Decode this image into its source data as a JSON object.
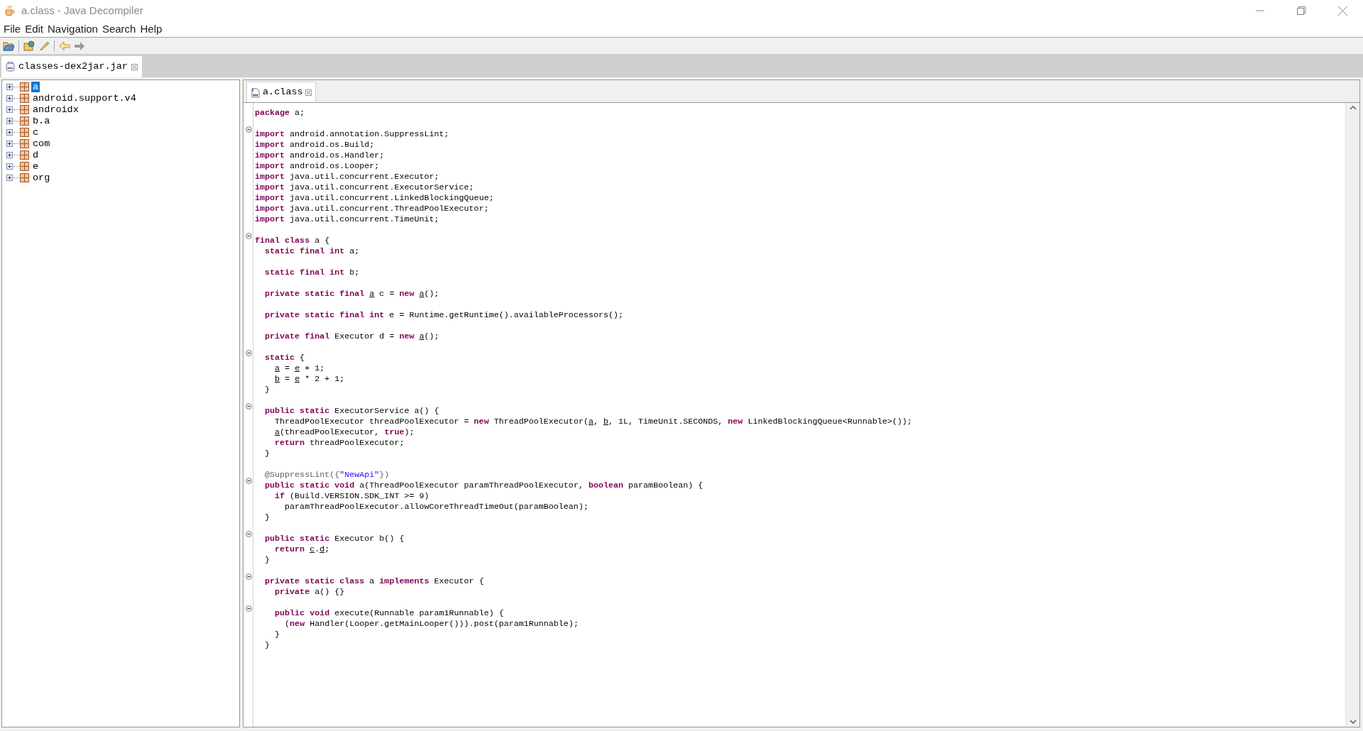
{
  "window": {
    "title": "a.class - Java Decompiler"
  },
  "menu": [
    {
      "label": "File"
    },
    {
      "label": "Edit"
    },
    {
      "label": "Navigation"
    },
    {
      "label": "Search"
    },
    {
      "label": "Help"
    }
  ],
  "left_tabs": [
    {
      "label": "classes-dex2jar.jar",
      "selected": true
    }
  ],
  "tree": {
    "items": [
      {
        "label": "a",
        "selected": true,
        "expanded": false
      },
      {
        "label": "android.support.v4",
        "selected": false,
        "expanded": false
      },
      {
        "label": "androidx",
        "selected": false,
        "expanded": false
      },
      {
        "label": "b.a",
        "selected": false,
        "expanded": false
      },
      {
        "label": "c",
        "selected": false,
        "expanded": false
      },
      {
        "label": "com",
        "selected": false,
        "expanded": false
      },
      {
        "label": "d",
        "selected": false,
        "expanded": false
      },
      {
        "label": "e",
        "selected": false,
        "expanded": false
      },
      {
        "label": "org",
        "selected": false,
        "expanded": false
      }
    ]
  },
  "editor_tabs": [
    {
      "label": "a.class",
      "selected": true
    }
  ],
  "code": {
    "lines": [
      {
        "kind": "code",
        "foldable": false,
        "tokens": [
          {
            "kind": "keyword",
            "text": "package"
          },
          {
            "kind": "plain",
            "text": " a;"
          }
        ]
      },
      {
        "kind": "blank"
      },
      {
        "kind": "code",
        "foldable": true,
        "tokens": [
          {
            "kind": "keyword",
            "text": "import"
          },
          {
            "kind": "plain",
            "text": " android.annotation.SuppressLint;"
          }
        ]
      },
      {
        "kind": "code",
        "foldable": false,
        "tokens": [
          {
            "kind": "keyword",
            "text": "import"
          },
          {
            "kind": "plain",
            "text": " android.os.Build;"
          }
        ]
      },
      {
        "kind": "code",
        "foldable": false,
        "tokens": [
          {
            "kind": "keyword",
            "text": "import"
          },
          {
            "kind": "plain",
            "text": " android.os.Handler;"
          }
        ]
      },
      {
        "kind": "code",
        "foldable": false,
        "tokens": [
          {
            "kind": "keyword",
            "text": "import"
          },
          {
            "kind": "plain",
            "text": " android.os.Looper;"
          }
        ]
      },
      {
        "kind": "code",
        "foldable": false,
        "tokens": [
          {
            "kind": "keyword",
            "text": "import"
          },
          {
            "kind": "plain",
            "text": " java.util.concurrent.Executor;"
          }
        ]
      },
      {
        "kind": "code",
        "foldable": false,
        "tokens": [
          {
            "kind": "keyword",
            "text": "import"
          },
          {
            "kind": "plain",
            "text": " java.util.concurrent.ExecutorService;"
          }
        ]
      },
      {
        "kind": "code",
        "foldable": false,
        "tokens": [
          {
            "kind": "keyword",
            "text": "import"
          },
          {
            "kind": "plain",
            "text": " java.util.concurrent.LinkedBlockingQueue;"
          }
        ]
      },
      {
        "kind": "code",
        "foldable": false,
        "tokens": [
          {
            "kind": "keyword",
            "text": "import"
          },
          {
            "kind": "plain",
            "text": " java.util.concurrent.ThreadPoolExecutor;"
          }
        ]
      },
      {
        "kind": "code",
        "foldable": false,
        "tokens": [
          {
            "kind": "keyword",
            "text": "import"
          },
          {
            "kind": "plain",
            "text": " java.util.concurrent.TimeUnit;"
          }
        ]
      },
      {
        "kind": "blank"
      },
      {
        "kind": "code",
        "foldable": true,
        "tokens": [
          {
            "kind": "keyword",
            "text": "final class"
          },
          {
            "kind": "plain",
            "text": " a {"
          }
        ]
      },
      {
        "kind": "code",
        "foldable": false,
        "tokens": [
          {
            "kind": "keyword",
            "text": "  static final int"
          },
          {
            "kind": "plain",
            "text": " a;"
          }
        ]
      },
      {
        "kind": "blank"
      },
      {
        "kind": "code",
        "foldable": false,
        "tokens": [
          {
            "kind": "keyword",
            "text": "  static final int"
          },
          {
            "kind": "plain",
            "text": " b;"
          }
        ]
      },
      {
        "kind": "blank"
      },
      {
        "kind": "code",
        "foldable": false,
        "tokens": [
          {
            "kind": "keyword",
            "text": "  private static final "
          },
          {
            "kind": "ref",
            "text": "a"
          },
          {
            "kind": "plain",
            "text": " c = "
          },
          {
            "kind": "keyword",
            "text": "new "
          },
          {
            "kind": "ref",
            "text": "a"
          },
          {
            "kind": "plain",
            "text": "();"
          }
        ]
      },
      {
        "kind": "blank"
      },
      {
        "kind": "code",
        "foldable": false,
        "tokens": [
          {
            "kind": "keyword",
            "text": "  private static final int"
          },
          {
            "kind": "plain",
            "text": " e = Runtime.getRuntime().availableProcessors();"
          }
        ]
      },
      {
        "kind": "blank"
      },
      {
        "kind": "code",
        "foldable": false,
        "tokens": [
          {
            "kind": "keyword",
            "text": "  private final"
          },
          {
            "kind": "plain",
            "text": " Executor d = "
          },
          {
            "kind": "keyword",
            "text": "new "
          },
          {
            "kind": "ref",
            "text": "a"
          },
          {
            "kind": "plain",
            "text": "();"
          }
        ]
      },
      {
        "kind": "blank"
      },
      {
        "kind": "code",
        "foldable": true,
        "tokens": [
          {
            "kind": "keyword",
            "text": "  static"
          },
          {
            "kind": "plain",
            "text": " {"
          }
        ]
      },
      {
        "kind": "code",
        "foldable": false,
        "tokens": [
          {
            "kind": "ref",
            "text": "    a"
          },
          {
            "kind": "plain",
            "text": " = "
          },
          {
            "kind": "ref",
            "text": "e"
          },
          {
            "kind": "plain",
            "text": " + 1;"
          }
        ]
      },
      {
        "kind": "code",
        "foldable": false,
        "tokens": [
          {
            "kind": "ref",
            "text": "    b"
          },
          {
            "kind": "plain",
            "text": " = "
          },
          {
            "kind": "ref",
            "text": "e"
          },
          {
            "kind": "plain",
            "text": " * 2 + 1;"
          }
        ]
      },
      {
        "kind": "code",
        "foldable": false,
        "tokens": [
          {
            "kind": "plain",
            "text": "  }"
          }
        ]
      },
      {
        "kind": "blank"
      },
      {
        "kind": "code",
        "foldable": true,
        "tokens": [
          {
            "kind": "keyword",
            "text": "  public static"
          },
          {
            "kind": "plain",
            "text": " ExecutorService a() {"
          }
        ]
      },
      {
        "kind": "code",
        "foldable": false,
        "tokens": [
          {
            "kind": "plain",
            "text": "    ThreadPoolExecutor threadPoolExecutor = "
          },
          {
            "kind": "keyword",
            "text": "new"
          },
          {
            "kind": "plain",
            "text": " ThreadPoolExecutor("
          },
          {
            "kind": "ref",
            "text": "a"
          },
          {
            "kind": "plain",
            "text": ", "
          },
          {
            "kind": "ref",
            "text": "b"
          },
          {
            "kind": "plain",
            "text": ", 1L, TimeUnit.SECONDS, "
          },
          {
            "kind": "keyword",
            "text": "new"
          },
          {
            "kind": "plain",
            "text": " LinkedBlockingQueue<Runnable>());"
          }
        ]
      },
      {
        "kind": "code",
        "foldable": false,
        "tokens": [
          {
            "kind": "ref",
            "text": "    a"
          },
          {
            "kind": "plain",
            "text": "(threadPoolExecutor, "
          },
          {
            "kind": "keyword",
            "text": "true"
          },
          {
            "kind": "plain",
            "text": ");"
          }
        ]
      },
      {
        "kind": "code",
        "foldable": false,
        "tokens": [
          {
            "kind": "keyword",
            "text": "    return"
          },
          {
            "kind": "plain",
            "text": " threadPoolExecutor;"
          }
        ]
      },
      {
        "kind": "code",
        "foldable": false,
        "tokens": [
          {
            "kind": "plain",
            "text": "  }"
          }
        ]
      },
      {
        "kind": "blank"
      },
      {
        "kind": "code",
        "foldable": false,
        "tokens": [
          {
            "kind": "annotation",
            "text": "  @SuppressLint({"
          },
          {
            "kind": "string",
            "text": "\"NewApi\""
          },
          {
            "kind": "annotation",
            "text": "})"
          }
        ]
      },
      {
        "kind": "code",
        "foldable": true,
        "tokens": [
          {
            "kind": "keyword",
            "text": "  public static void"
          },
          {
            "kind": "plain",
            "text": " a(ThreadPoolExecutor paramThreadPoolExecutor, "
          },
          {
            "kind": "keyword",
            "text": "boolean"
          },
          {
            "kind": "plain",
            "text": " paramBoolean) {"
          }
        ]
      },
      {
        "kind": "code",
        "foldable": false,
        "tokens": [
          {
            "kind": "keyword",
            "text": "    if"
          },
          {
            "kind": "plain",
            "text": " (Build.VERSION.SDK_INT >= 9)"
          }
        ]
      },
      {
        "kind": "code",
        "foldable": false,
        "tokens": [
          {
            "kind": "plain",
            "text": "      paramThreadPoolExecutor.allowCoreThreadTimeOut(paramBoolean);"
          }
        ]
      },
      {
        "kind": "code",
        "foldable": false,
        "tokens": [
          {
            "kind": "plain",
            "text": "  }"
          }
        ]
      },
      {
        "kind": "blank"
      },
      {
        "kind": "code",
        "foldable": true,
        "tokens": [
          {
            "kind": "keyword",
            "text": "  public static"
          },
          {
            "kind": "plain",
            "text": " Executor b() {"
          }
        ]
      },
      {
        "kind": "code",
        "foldable": false,
        "tokens": [
          {
            "kind": "keyword",
            "text": "    return "
          },
          {
            "kind": "ref",
            "text": "c"
          },
          {
            "kind": "plain",
            "text": "."
          },
          {
            "kind": "ref",
            "text": "d"
          },
          {
            "kind": "plain",
            "text": ";"
          }
        ]
      },
      {
        "kind": "code",
        "foldable": false,
        "tokens": [
          {
            "kind": "plain",
            "text": "  }"
          }
        ]
      },
      {
        "kind": "blank"
      },
      {
        "kind": "code",
        "foldable": true,
        "tokens": [
          {
            "kind": "keyword",
            "text": "  private static class"
          },
          {
            "kind": "plain",
            "text": " a "
          },
          {
            "kind": "keyword",
            "text": "implements"
          },
          {
            "kind": "plain",
            "text": " Executor {"
          }
        ]
      },
      {
        "kind": "code",
        "foldable": false,
        "tokens": [
          {
            "kind": "keyword",
            "text": "    private"
          },
          {
            "kind": "plain",
            "text": " a() {}"
          }
        ]
      },
      {
        "kind": "blank"
      },
      {
        "kind": "code",
        "foldable": true,
        "tokens": [
          {
            "kind": "keyword",
            "text": "    public void"
          },
          {
            "kind": "plain",
            "text": " execute(Runnable param1Runnable) {"
          }
        ]
      },
      {
        "kind": "code",
        "foldable": false,
        "tokens": [
          {
            "kind": "plain",
            "text": "      ("
          },
          {
            "kind": "keyword",
            "text": "new"
          },
          {
            "kind": "plain",
            "text": " Handler(Looper.getMainLooper())).post(param1Runnable);"
          }
        ]
      },
      {
        "kind": "code",
        "foldable": false,
        "tokens": [
          {
            "kind": "plain",
            "text": "    }"
          }
        ]
      },
      {
        "kind": "code",
        "foldable": false,
        "tokens": [
          {
            "kind": "plain",
            "text": "  }"
          }
        ]
      }
    ]
  }
}
